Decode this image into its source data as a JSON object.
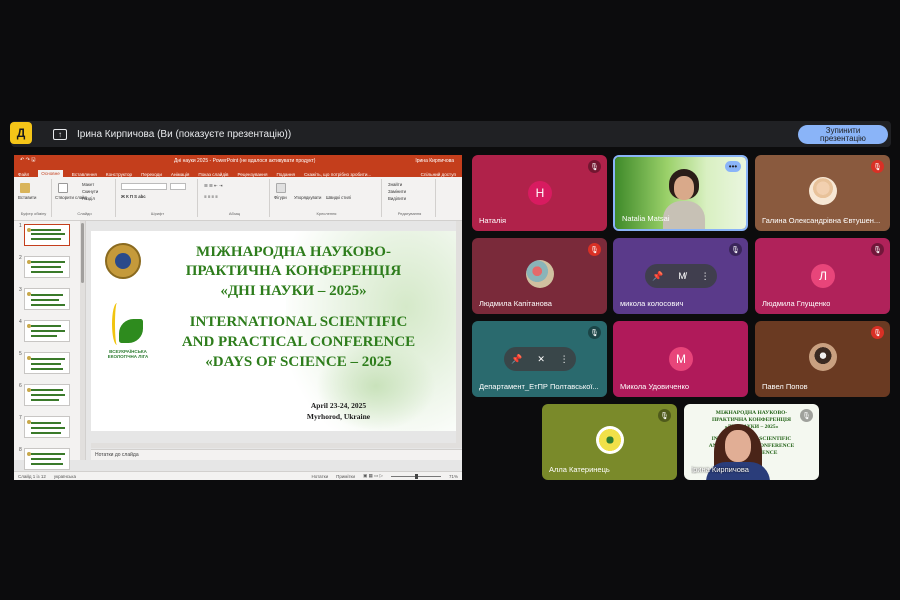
{
  "app": {
    "badge": "Д",
    "presenting_text": "Ірина Кирпичова (Ви (показуєте презентацію))",
    "stop_button": "Зупинити\nпрезентацію"
  },
  "ppt": {
    "title_left": "↶ ↷ 🖫",
    "title_center": "Дні науки 2025 - PowerPoint (не вдалося активувати продукт)",
    "title_right": "Ірина Кирпичова",
    "tabs": [
      "Файл",
      "Основне",
      "Вставлення",
      "Конструктор",
      "Переходи",
      "Анімація",
      "Показ слайдів",
      "Рецензування",
      "Подання",
      "Скажіть, що потрібно зробити..."
    ],
    "share": "Спільний доступ",
    "ribbon": {
      "paste": "Вставити",
      "clipboard": "Буфер обміну",
      "new_slide": "Створити слайд",
      "layout": "Макет",
      "reset": "Скинути",
      "section": "Розділ",
      "slides": "Слайди",
      "font": "Шрифт",
      "paragraph": "Абзац",
      "shapes": "Фігури",
      "arrange": "Упорядкувати",
      "quick_styles": "Швидкі стилі",
      "drawing": "Креслення",
      "find": "Знайти",
      "replace": "Замінити",
      "select": "Виділити",
      "editing": "Редагування"
    },
    "slide_numbers": [
      "1",
      "2",
      "3",
      "4",
      "5",
      "6",
      "7",
      "8"
    ],
    "slide": {
      "line1": "МІЖНАРОДНА НАУКОВО-",
      "line2": "ПРАКТИЧНА КОНФЕРЕНЦІЯ",
      "line3": "«ДНІ НАУКИ – 2025»",
      "line4": "INTERNATIONAL SCIENTIFIC",
      "line5": "AND PRACTICAL CONFERENCE",
      "line6": "«DAYS OF SCIENCE – 2025",
      "date": "April 23-24, 2025",
      "place": "Myrhorod, Ukraine",
      "logo_text": "ВСЕУКРАЇНСЬКА ЕКОЛОГІЧНА ЛІГА"
    },
    "notes": "Нотатки до слайда",
    "status_left": "Слайд 1 із 12",
    "status_lang": "українська",
    "status_notes": "Нотатки",
    "status_comments": "Примітки",
    "zoom": "71%"
  },
  "participants": [
    {
      "name": "Наталія",
      "initial": "Н",
      "bg": "#b0224a"
    },
    {
      "name": "Natalia Matsai",
      "initial": "",
      "bg": "#6aaa3a"
    },
    {
      "name": "Галина Олександрівна Євтушен...",
      "initial": "",
      "bg": "#8a5a3e"
    },
    {
      "name": "Людмила Капітанова",
      "initial": "",
      "bg": "#7a2a3a"
    },
    {
      "name": "микола колосович",
      "initial": "",
      "bg": "#5a3a8a"
    },
    {
      "name": "Людмила Глущенко",
      "initial": "Л",
      "bg": "#b0225a"
    },
    {
      "name": "Департамент_ЕтПР Полтавської...",
      "initial": "",
      "bg": "#2a6a6e"
    },
    {
      "name": "Микола Удовиченко",
      "initial": "М",
      "bg": "#b01a5a"
    },
    {
      "name": "Павел Попов",
      "initial": "",
      "bg": "#6a3a22"
    },
    {
      "name": "Алла Катеринець",
      "initial": "",
      "bg": "#7a8a2a"
    },
    {
      "name": "Ірина Кирпичова",
      "initial": "",
      "bg": "#f4f8f0"
    }
  ],
  "mini_slide": {
    "l1": "МІЖНАРОДНА НАУКОВО-",
    "l2": "ПРАКТИЧНА КОНФЕРЕНЦІЯ",
    "l3": "«ДНІ НАУКИ – 2025»",
    "l4": "INTERNATIONAL SCIENTIFIC",
    "l5": "AND PRACTICAL CONFERENCE",
    "l6": "«DAYS OF SCIENCE",
    "l7": "2025"
  },
  "icons": {
    "present": "present-to-all-icon",
    "mic_off": "mic-off-icon",
    "pin": "pin-icon",
    "more": "more-vert-icon"
  },
  "colors": {
    "accent": "#8ab4f8",
    "ppt_brand": "#c43e1c",
    "slide_green": "#2e7d1c",
    "badge": "#f5c518"
  }
}
